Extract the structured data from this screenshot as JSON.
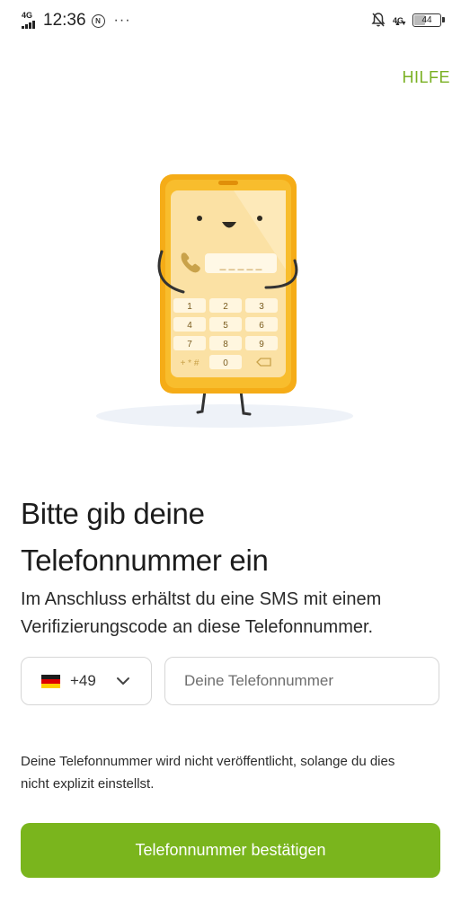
{
  "status_bar": {
    "network_left": "4G",
    "time": "12:36",
    "notification_glyph": "N",
    "more": "···",
    "network_right": "4G",
    "battery": "44",
    "icons": [
      "signal-icon",
      "notification-icon",
      "more-icon",
      "bell-off-icon",
      "network-4g-icon",
      "battery-icon"
    ]
  },
  "header": {
    "help_label": "HILFE"
  },
  "illustration": {
    "keys": [
      "1",
      "2",
      "3",
      "4",
      "5",
      "6",
      "7",
      "8",
      "9",
      "0"
    ],
    "code_placeholder": "_ _ _ _ _",
    "star_key": "+ * #"
  },
  "main": {
    "title_line1": "Bitte gib deine",
    "title_line2": "Telefonnummer ein",
    "subtitle_line1": "Im Anschluss erhältst du eine SMS mit einem",
    "subtitle_line2": "Verifizierungscode an diese Telefonnummer."
  },
  "phone_form": {
    "country_flag": "germany-flag-icon",
    "country_code": "+49",
    "phone_placeholder": "Deine Telefonnummer",
    "phone_value": ""
  },
  "notice": {
    "line1": "Deine Telefonnummer wird nicht veröffentlicht, solange du dies",
    "line2": "nicht explizit einstellst."
  },
  "actions": {
    "confirm_label": "Telefonnummer bestätigen"
  },
  "colors": {
    "accent": "#7ab51d",
    "help_link": "#79b022",
    "phone_body": "#f5ac17",
    "screen": "#fbe1a4"
  }
}
